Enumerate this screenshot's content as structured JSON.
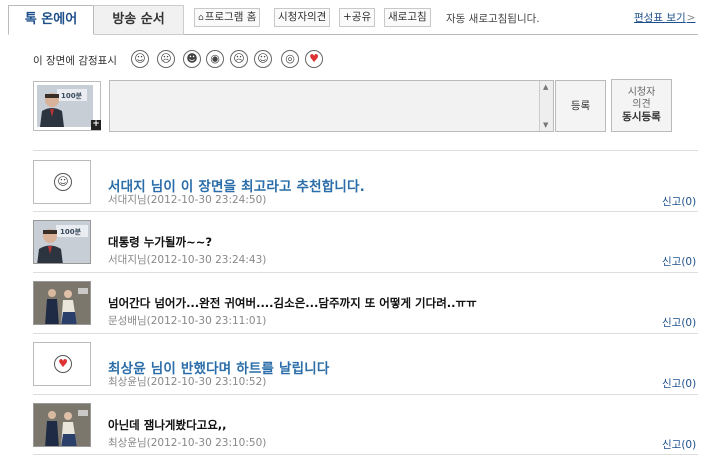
{
  "tabs": [
    {
      "label": "톡 온에어",
      "active": true
    },
    {
      "label": "방송 순서",
      "active": false
    }
  ],
  "toolbar": {
    "program_home": "프로그램 홈",
    "viewer_opinion": "시청자의견",
    "share": "+공유",
    "refresh": "새로고침",
    "auto_refresh_text": "자동 새로고침됩니다.",
    "schedule_link": "편성표 보기",
    "schedule_arrow": ">"
  },
  "emotion": {
    "label": "이 장면에 감정표시",
    "icons": [
      "smile-icon",
      "cry-icon",
      "laugh-icon",
      "surprised-icon",
      "angry-icon",
      "sleepy-icon",
      "dizzy-icon",
      "heart-eyes-icon"
    ],
    "glyphs": [
      "☺",
      "☹",
      "☻",
      "◉",
      "☹",
      "☺",
      "◎",
      "♥"
    ]
  },
  "input": {
    "plus": "+",
    "submit": "등록",
    "co_register_line1": "시청자",
    "co_register_line2": "의견",
    "co_register_line3": "동시등록"
  },
  "comments": [
    {
      "type": "emotion",
      "glyph": "☺",
      "text": "서대지 님이 이 장면을 최고라고 추천합니다.",
      "meta": "서대지님(2012-10-30 23:24:50)",
      "report": "신고(0)"
    },
    {
      "type": "photo",
      "text": "대통령 누가될까~~?",
      "meta": "서대지님(2012-10-30 23:24:43)",
      "report": "신고(0)"
    },
    {
      "type": "drama",
      "text": "넘어간다 넘어가...완전 귀여버....김소은...담주까지 또 어떻게 기다려..ㅠㅠ",
      "meta": "문성배님(2012-10-30 23:11:01)",
      "report": "신고(0)"
    },
    {
      "type": "emotion",
      "glyph": "♥",
      "text": "최상윤 님이 반했다며 하트를 날립니다",
      "meta": "최상윤님(2012-10-30 23:10:52)",
      "report": "신고(0)"
    },
    {
      "type": "drama",
      "text": "아닌데 잼나게봤다고요,,",
      "meta": "최상윤님(2012-10-30 23:10:50)",
      "report": "신고(0)"
    }
  ]
}
